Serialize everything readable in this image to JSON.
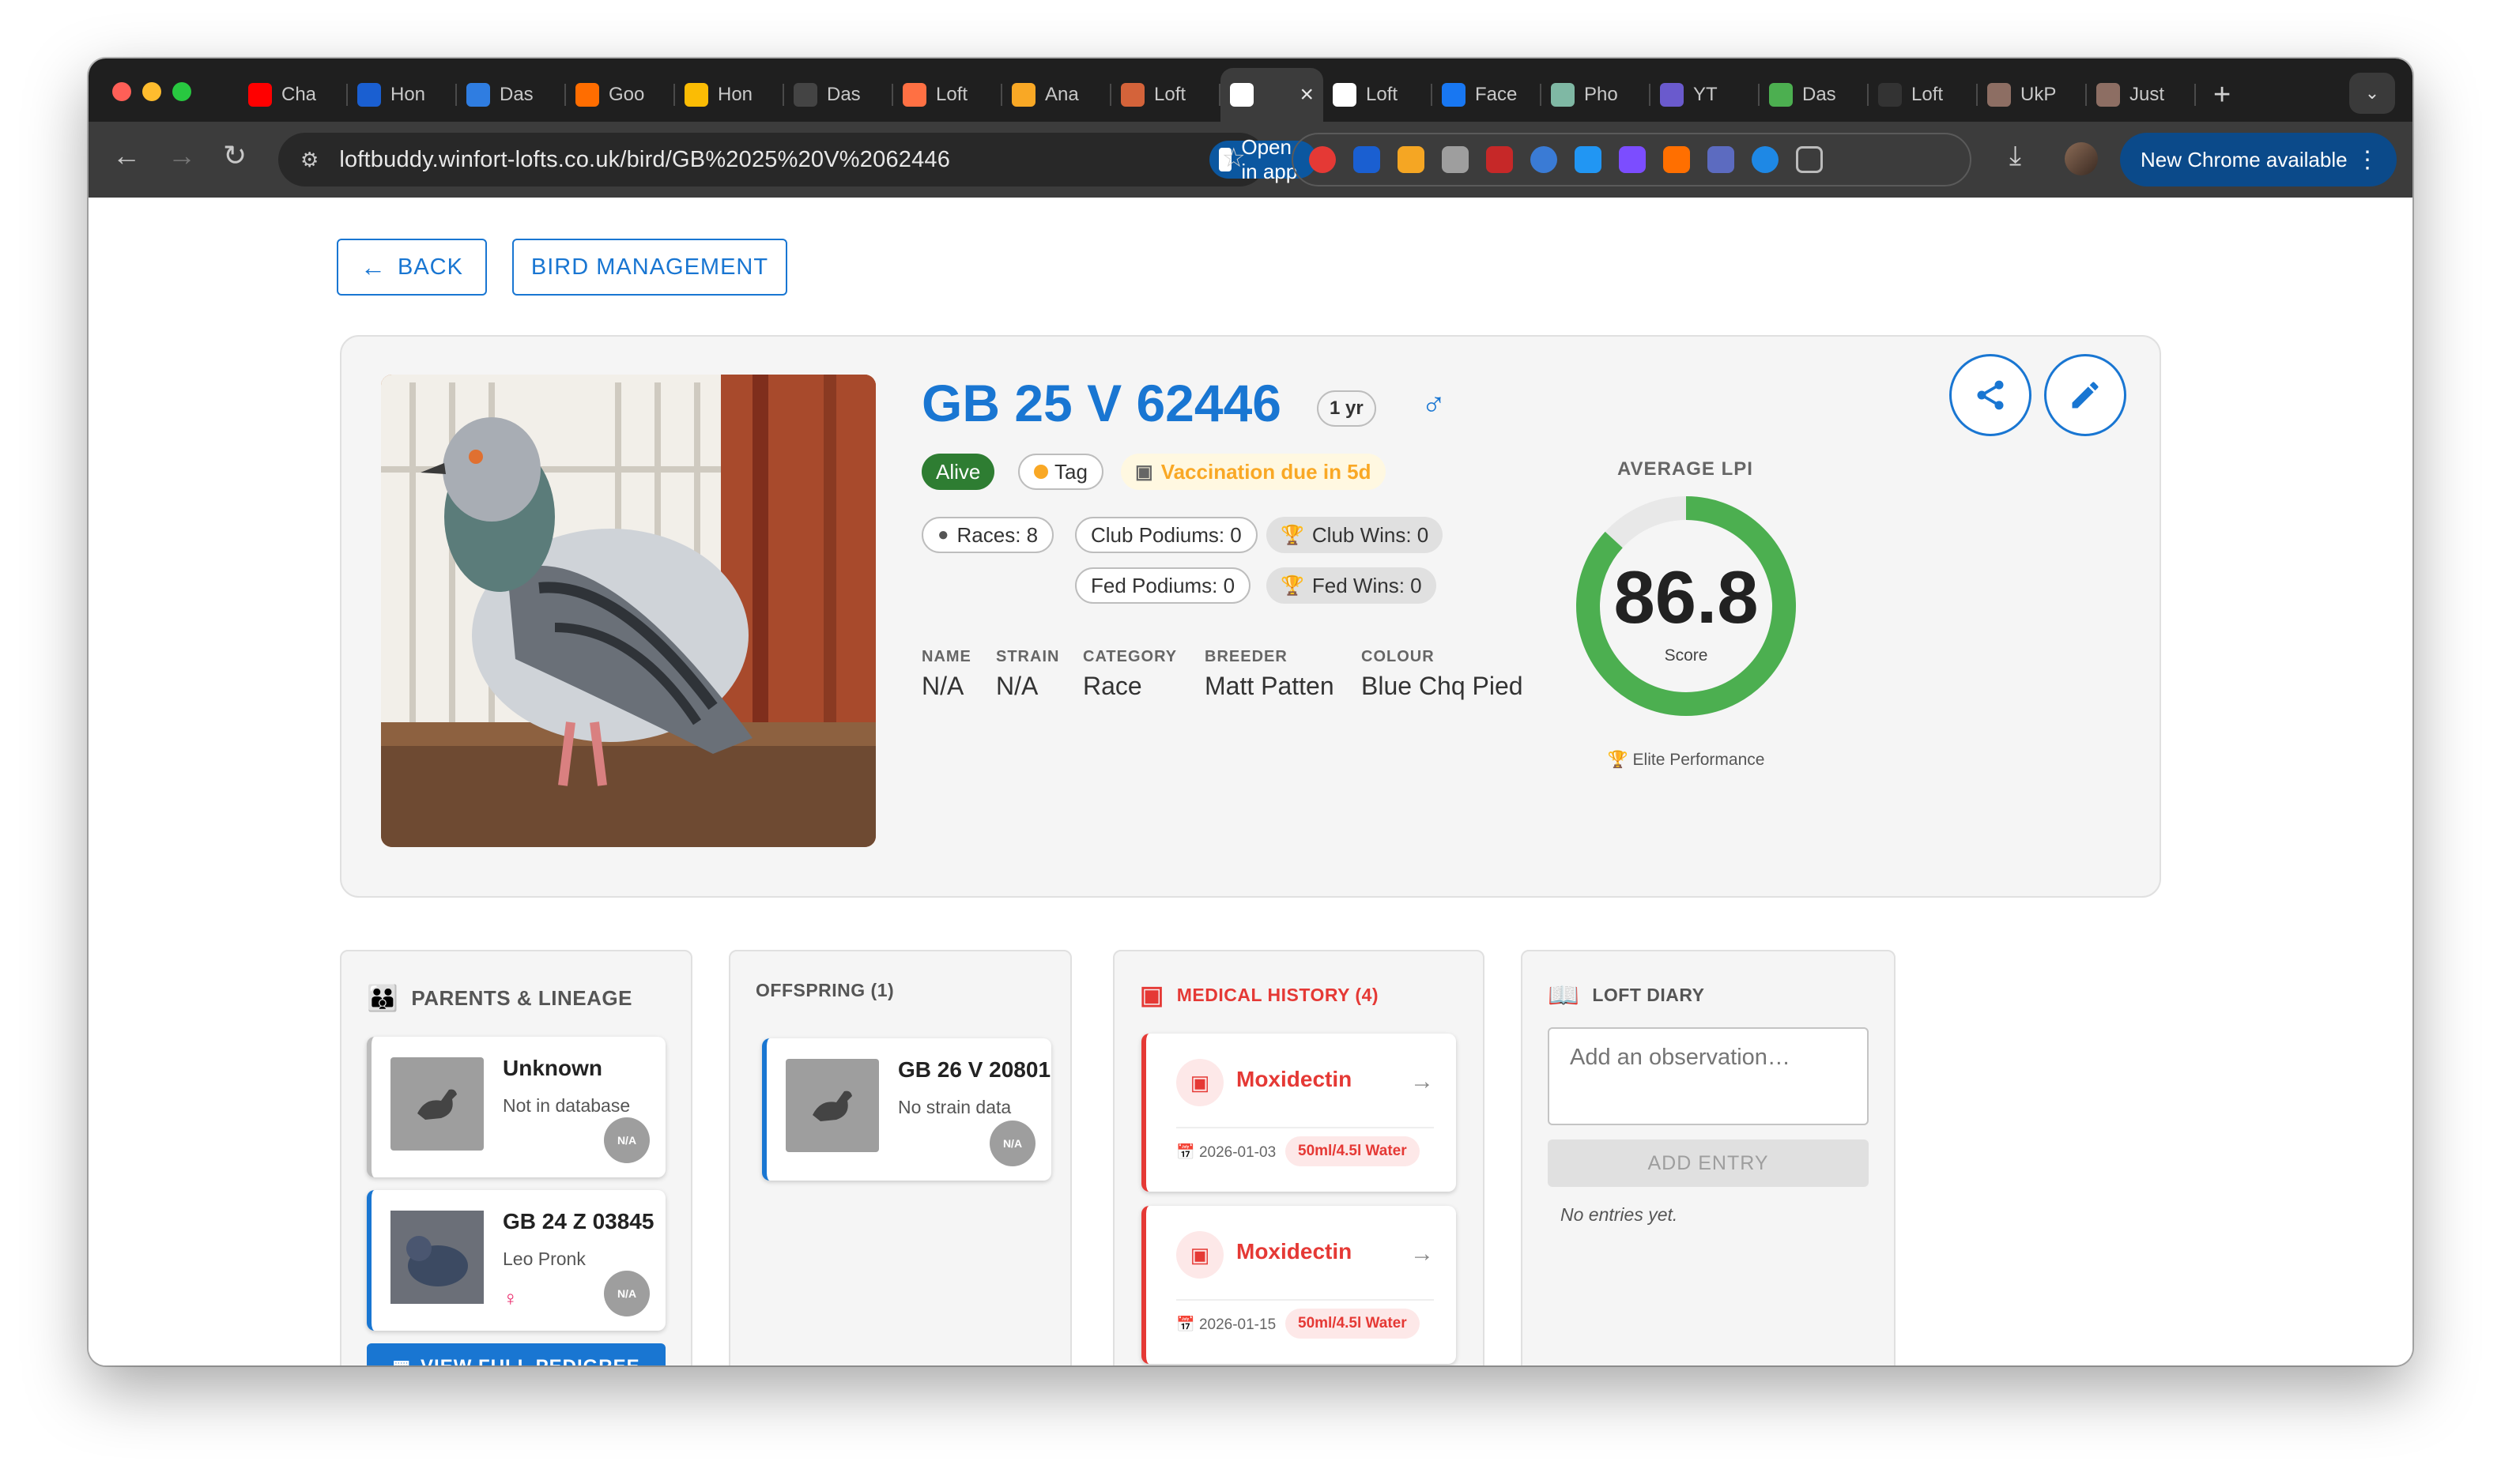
{
  "browser": {
    "tabs": [
      {
        "label": "Cha",
        "icon": "youtube-icon",
        "color": "#ff0000"
      },
      {
        "label": "Hon",
        "icon": "iq-icon",
        "color": "#1a5fd1"
      },
      {
        "label": "Das",
        "icon": "play-icon",
        "color": "#2f7de1"
      },
      {
        "label": "Goo",
        "icon": "google-icon",
        "color": "#ff6d00"
      },
      {
        "label": "Hon",
        "icon": "ads-icon",
        "color": "#fbbc04"
      },
      {
        "label": "Das",
        "icon": "threads-icon",
        "color": "#444444"
      },
      {
        "label": "Loft",
        "icon": "fire-icon",
        "color": "#ff7043"
      },
      {
        "label": "Ana",
        "icon": "analytics-icon",
        "color": "#f9a825"
      },
      {
        "label": "Loft",
        "icon": "burst-icon",
        "color": "#d4633a"
      },
      {
        "label": "",
        "icon": "loftbuddy-icon",
        "color": "#ffffff",
        "active": true
      },
      {
        "label": "Loft",
        "icon": "loftbuddy-icon",
        "color": "#ffffff"
      },
      {
        "label": "Face",
        "icon": "facebook-icon",
        "color": "#1877f2"
      },
      {
        "label": "Pho",
        "icon": "phone-icon",
        "color": "#7fb8a4"
      },
      {
        "label": "YT",
        "icon": "heart-icon",
        "color": "#6a5acd"
      },
      {
        "label": "Das",
        "icon": "spark-icon",
        "color": "#4caf50"
      },
      {
        "label": "Loft",
        "icon": "openai-icon",
        "color": "#333333"
      },
      {
        "label": "UkP",
        "icon": "pigeon-icon",
        "color": "#8d6e63"
      },
      {
        "label": "Just",
        "icon": "pigeon-icon",
        "color": "#8d6e63"
      }
    ],
    "url": "loftbuddy.winfort-lofts.co.uk/bird/GB%2025%20V%2062446",
    "open_in_app": "Open in app",
    "new_chrome": "New Chrome available"
  },
  "nav": {
    "back_label": "BACK",
    "bird_management_label": "BIRD MANAGEMENT"
  },
  "bird": {
    "ring": "GB 25 V 62446",
    "age": "1 yr",
    "sex_symbol": "♂",
    "status": "Alive",
    "tag": "Tag",
    "vaccination": "Vaccination due in 5d",
    "stats": {
      "races": "Races: 8",
      "club_podiums": "Club Podiums: 0",
      "club_wins": "Club Wins: 0",
      "fed_podiums": "Fed Podiums: 0",
      "fed_wins": "Fed Wins: 0"
    },
    "fields": {
      "name_label": "NAME",
      "name": "N/A",
      "strain_label": "STRAIN",
      "strain": "N/A",
      "category_label": "CATEGORY",
      "category": "Race",
      "breeder_label": "BREEDER",
      "breeder": "Matt Patten",
      "colour_label": "COLOUR",
      "colour": "Blue Chq Pied"
    },
    "lpi": {
      "label": "AVERAGE LPI",
      "value": "86.8",
      "value_number": 86.8,
      "sub": "Score",
      "rating": "Elite Performance"
    }
  },
  "parents": {
    "title": "PARENTS & LINEAGE",
    "items": [
      {
        "ring": "Unknown",
        "detail": "Not in database",
        "badge": "N/A"
      },
      {
        "ring": "GB 24 Z 03845",
        "detail": "Leo Pronk",
        "badge": "N/A",
        "sex": "♀"
      }
    ],
    "pedigree_button": "VIEW FULL PEDIGREE"
  },
  "offspring": {
    "title": "OFFSPRING (1)",
    "items": [
      {
        "ring": "GB 26 V 20801",
        "detail": "No strain data",
        "badge": "N/A"
      }
    ]
  },
  "medical": {
    "title": "MEDICAL HISTORY (4)",
    "items": [
      {
        "name": "Moxidectin",
        "date": "2026-01-03",
        "dose": "50ml/4.5l Water"
      },
      {
        "name": "Moxidectin",
        "date": "2026-01-15",
        "dose": "50ml/4.5l Water"
      }
    ]
  },
  "diary": {
    "title": "LOFT DIARY",
    "placeholder": "Add an observation…",
    "add_button": "ADD ENTRY",
    "empty": "No entries yet."
  },
  "colors": {
    "primary": "#1976d2",
    "alive": "#2e7d32",
    "vaccination": "#f9a825",
    "gauge": "#4caf50",
    "medical": "#e53935"
  }
}
